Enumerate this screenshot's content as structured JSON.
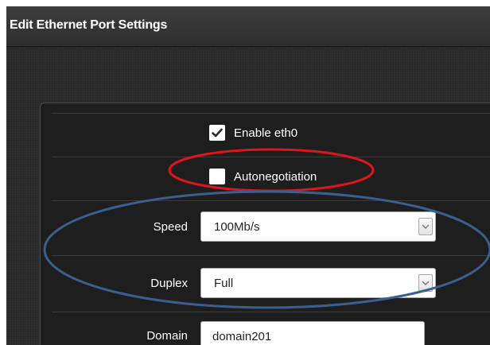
{
  "window": {
    "title": "Edit Ethernet Port Settings"
  },
  "form": {
    "enable": {
      "label": "Enable eth0",
      "checked": true
    },
    "autonegotiation": {
      "label": "Autonegotiation",
      "checked": false
    },
    "speed": {
      "label": "Speed",
      "value": "100Mb/s"
    },
    "duplex": {
      "label": "Duplex",
      "value": "Full"
    },
    "domain": {
      "label": "Domain",
      "value": "domain201"
    }
  },
  "icons": {
    "enable_checkbox": "checkmark-icon",
    "select_arrow": "chevron-down-icon"
  },
  "colors": {
    "window_background": "#2c2c2c",
    "panel_background": "#1e1e1e",
    "highlight_red": "#e0141e",
    "highlight_blue": "#3a5f8f"
  }
}
